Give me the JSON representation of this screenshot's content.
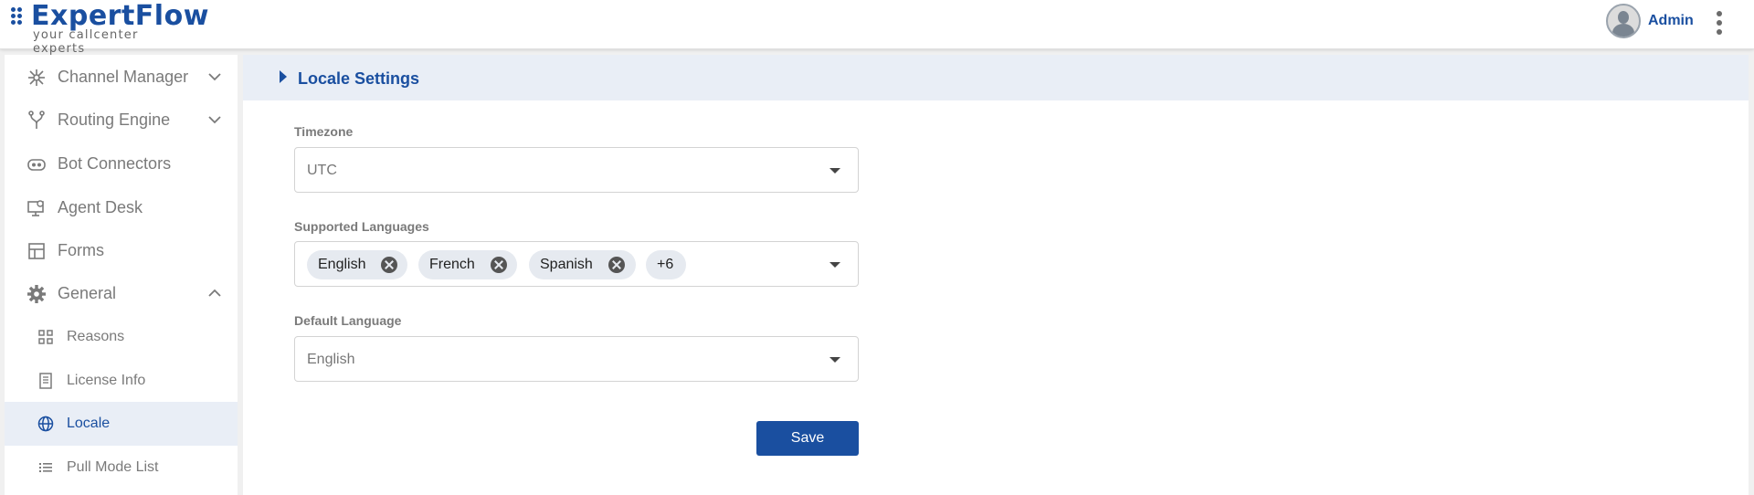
{
  "brand": {
    "name": "ExpertFlow",
    "tagline": "your callcenter experts",
    "color": "#1a4fa0"
  },
  "header": {
    "user_name": "Admin",
    "avatar_icon": "user-avatar-icon",
    "menu_icon": "kebab-menu-icon"
  },
  "sidebar": {
    "items": [
      {
        "label": "Channel Manager",
        "icon": "network-icon",
        "expandable": true,
        "expanded": false
      },
      {
        "label": "Routing Engine",
        "icon": "fork-icon",
        "expandable": true,
        "expanded": false
      },
      {
        "label": "Bot Connectors",
        "icon": "bot-icon",
        "expandable": false
      },
      {
        "label": "Agent Desk",
        "icon": "monitor-icon",
        "expandable": false
      },
      {
        "label": "Forms",
        "icon": "form-icon",
        "expandable": false
      },
      {
        "label": "General",
        "icon": "gear-icon",
        "expandable": true,
        "expanded": true
      }
    ],
    "sub_items": [
      {
        "label": "Reasons",
        "icon": "grid-icon"
      },
      {
        "label": "License Info",
        "icon": "document-icon"
      },
      {
        "label": "Locale",
        "icon": "globe-icon",
        "active": true
      },
      {
        "label": "Pull Mode List",
        "icon": "list-icon"
      }
    ]
  },
  "main": {
    "section_title": "Locale Settings",
    "timezone": {
      "label": "Timezone",
      "value": "UTC"
    },
    "supported_languages": {
      "label": "Supported Languages",
      "chips": [
        "English",
        "French",
        "Spanish"
      ],
      "more": "+6"
    },
    "default_language": {
      "label": "Default Language",
      "value": "English"
    },
    "save_label": "Save"
  }
}
